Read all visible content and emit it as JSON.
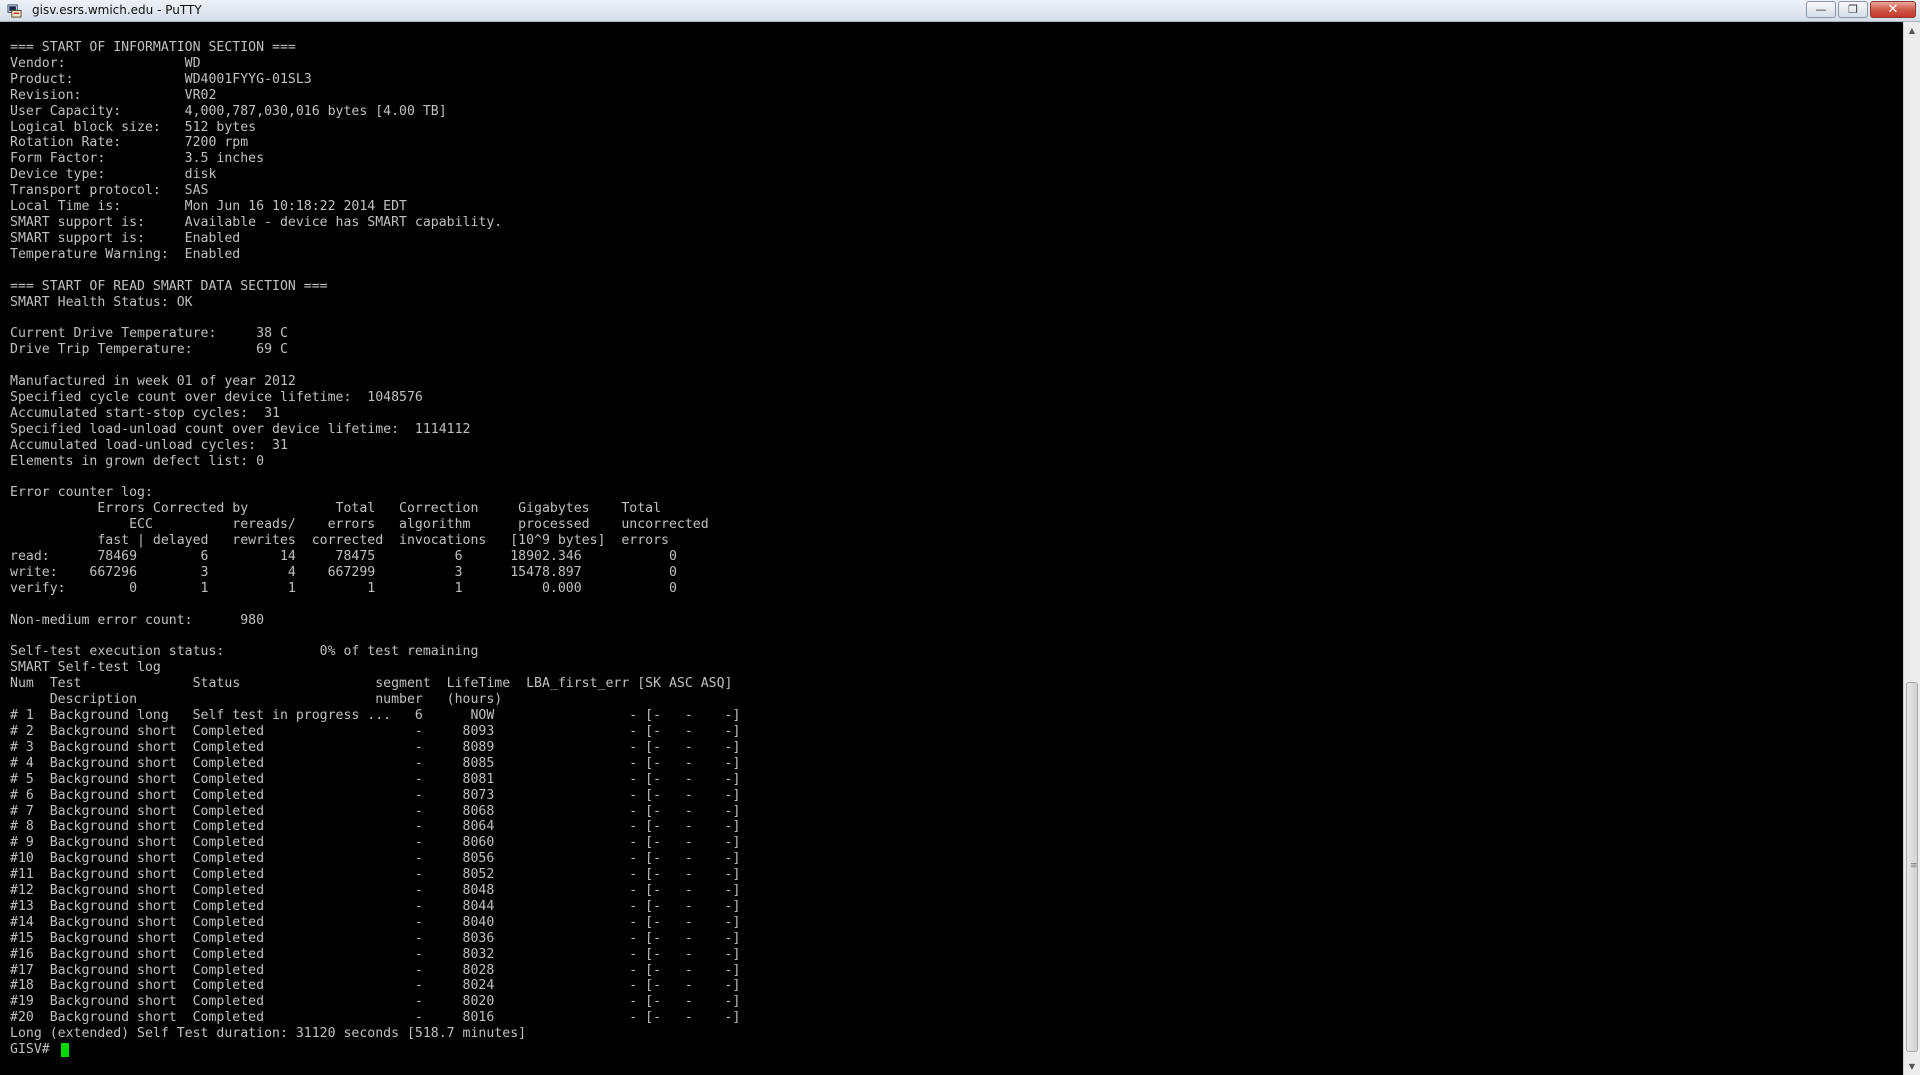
{
  "window": {
    "title": "gisv.esrs.wmich.edu - PuTTY",
    "app_icon": "putty-icon",
    "minimize_glyph": "—",
    "maximize_glyph": "❐",
    "close_glyph": "✕"
  },
  "terminal": {
    "output": "=== START OF INFORMATION SECTION ===\nVendor:               WD\nProduct:              WD4001FYYG-01SL3\nRevision:             VR02\nUser Capacity:        4,000,787,030,016 bytes [4.00 TB]\nLogical block size:   512 bytes\nRotation Rate:        7200 rpm\nForm Factor:          3.5 inches\nDevice type:          disk\nTransport protocol:   SAS\nLocal Time is:        Mon Jun 16 10:18:22 2014 EDT\nSMART support is:     Available - device has SMART capability.\nSMART support is:     Enabled\nTemperature Warning:  Enabled\n\n=== START OF READ SMART DATA SECTION ===\nSMART Health Status: OK\n\nCurrent Drive Temperature:     38 C\nDrive Trip Temperature:        69 C\n\nManufactured in week 01 of year 2012\nSpecified cycle count over device lifetime:  1048576\nAccumulated start-stop cycles:  31\nSpecified load-unload count over device lifetime:  1114112\nAccumulated load-unload cycles:  31\nElements in grown defect list: 0\n\nError counter log:\n           Errors Corrected by           Total   Correction     Gigabytes    Total\n               ECC          rereads/    errors   algorithm      processed    uncorrected\n           fast | delayed   rewrites  corrected  invocations   [10^9 bytes]  errors\nread:      78469        6         14     78475          6      18902.346           0\nwrite:    667296        3          4    667299          3      15478.897           0\nverify:        0        1          1         1          1          0.000           0\n\nNon-medium error count:      980\n\nSelf-test execution status:            0% of test remaining\nSMART Self-test log\nNum  Test              Status                 segment  LifeTime  LBA_first_err [SK ASC ASQ]\n     Description                              number   (hours)\n# 1  Background long   Self test in progress ...   6      NOW                 - [-   -    -]\n# 2  Background short  Completed                   -     8093                 - [-   -    -]\n# 3  Background short  Completed                   -     8089                 - [-   -    -]\n# 4  Background short  Completed                   -     8085                 - [-   -    -]\n# 5  Background short  Completed                   -     8081                 - [-   -    -]\n# 6  Background short  Completed                   -     8073                 - [-   -    -]\n# 7  Background short  Completed                   -     8068                 - [-   -    -]\n# 8  Background short  Completed                   -     8064                 - [-   -    -]\n# 9  Background short  Completed                   -     8060                 - [-   -    -]\n#10  Background short  Completed                   -     8056                 - [-   -    -]\n#11  Background short  Completed                   -     8052                 - [-   -    -]\n#12  Background short  Completed                   -     8048                 - [-   -    -]\n#13  Background short  Completed                   -     8044                 - [-   -    -]\n#14  Background short  Completed                   -     8040                 - [-   -    -]\n#15  Background short  Completed                   -     8036                 - [-   -    -]\n#16  Background short  Completed                   -     8032                 - [-   -    -]\n#17  Background short  Completed                   -     8028                 - [-   -    -]\n#18  Background short  Completed                   -     8024                 - [-   -    -]\n#19  Background short  Completed                   -     8020                 - [-   -    -]\n#20  Background short  Completed                   -     8016                 - [-   -    -]\nLong (extended) Self Test duration: 31120 seconds [518.7 minutes]\n",
    "prompt": "GISV# ",
    "text_color": "#c0c0c0",
    "background_color": "#000000",
    "cursor_color": "#00d800"
  },
  "scrollbar": {
    "up_glyph": "▲",
    "down_glyph": "▼",
    "grip_glyph": "≡"
  }
}
